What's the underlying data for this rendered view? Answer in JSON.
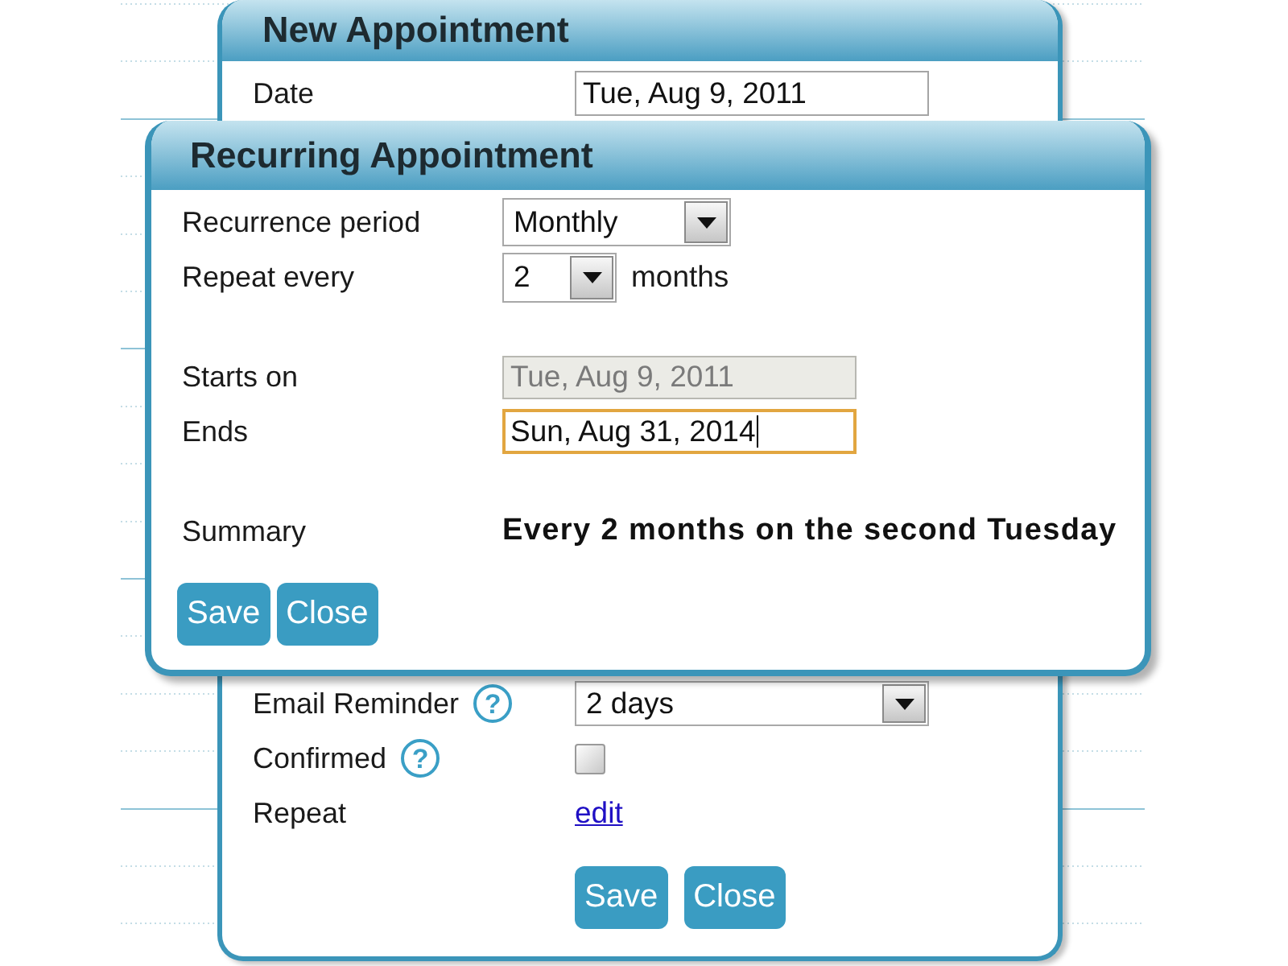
{
  "new_appointment": {
    "title": "New Appointment",
    "sections": [
      {
        "fields": [
          {
            "kind": "date",
            "label": "Date",
            "value": "Tue, Aug 9, 2011",
            "disabled": false,
            "focused": false
          }
        ]
      },
      {
        "fields": [
          {
            "kind": "select",
            "label": "Email Reminder",
            "help": "?",
            "value": "2 days"
          },
          {
            "kind": "checkbox",
            "label": "Confirmed",
            "help": "?",
            "checked": false
          },
          {
            "kind": "link",
            "label": "Repeat",
            "link": "edit"
          }
        ]
      }
    ],
    "buttons": [
      "Save",
      "Close"
    ]
  },
  "recurring_appointment": {
    "title": "Recurring Appointment",
    "sections": [
      {
        "fields": [
          {
            "kind": "select",
            "label": "Recurrence period",
            "value": "Monthly"
          },
          {
            "kind": "select",
            "label": "Repeat every",
            "value": "2",
            "unit": "months"
          }
        ]
      },
      {
        "fields": [
          {
            "kind": "date",
            "label": "Starts on",
            "value": "Tue, Aug 9, 2011",
            "disabled": true,
            "focused": false
          },
          {
            "kind": "date",
            "label": "Ends",
            "value": "Sun, Aug 31, 2014",
            "disabled": false,
            "focused": true
          }
        ]
      },
      {
        "fields": [
          {
            "kind": "summary",
            "label": "Summary",
            "value": "Every 2 months on the second Tuesday"
          }
        ]
      }
    ],
    "buttons": [
      "Save",
      "Close"
    ]
  }
}
